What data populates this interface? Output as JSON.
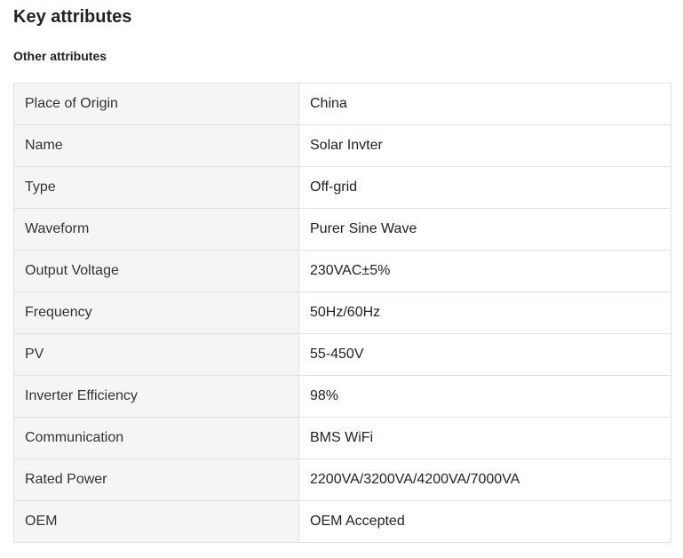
{
  "page": {
    "title": "Key attributes",
    "section_title": "Other attributes"
  },
  "attributes": [
    {
      "key": "Place of Origin",
      "value": "China"
    },
    {
      "key": "Name",
      "value": "Solar Invter"
    },
    {
      "key": "Type",
      "value": "Off-grid"
    },
    {
      "key": "Waveform",
      "value": "Purer Sine Wave"
    },
    {
      "key": "Output Voltage",
      "value": "230VAC±5%"
    },
    {
      "key": "Frequency",
      "value": "50Hz/60Hz"
    },
    {
      "key": "PV",
      "value": "55-450V"
    },
    {
      "key": "Inverter Efficiency",
      "value": "98%"
    },
    {
      "key": "Communication",
      "value": "BMS WiFi"
    },
    {
      "key": "Rated Power",
      "value": "2200VA/3200VA/4200VA/7000VA"
    },
    {
      "key": "OEM",
      "value": "OEM Accepted"
    }
  ]
}
